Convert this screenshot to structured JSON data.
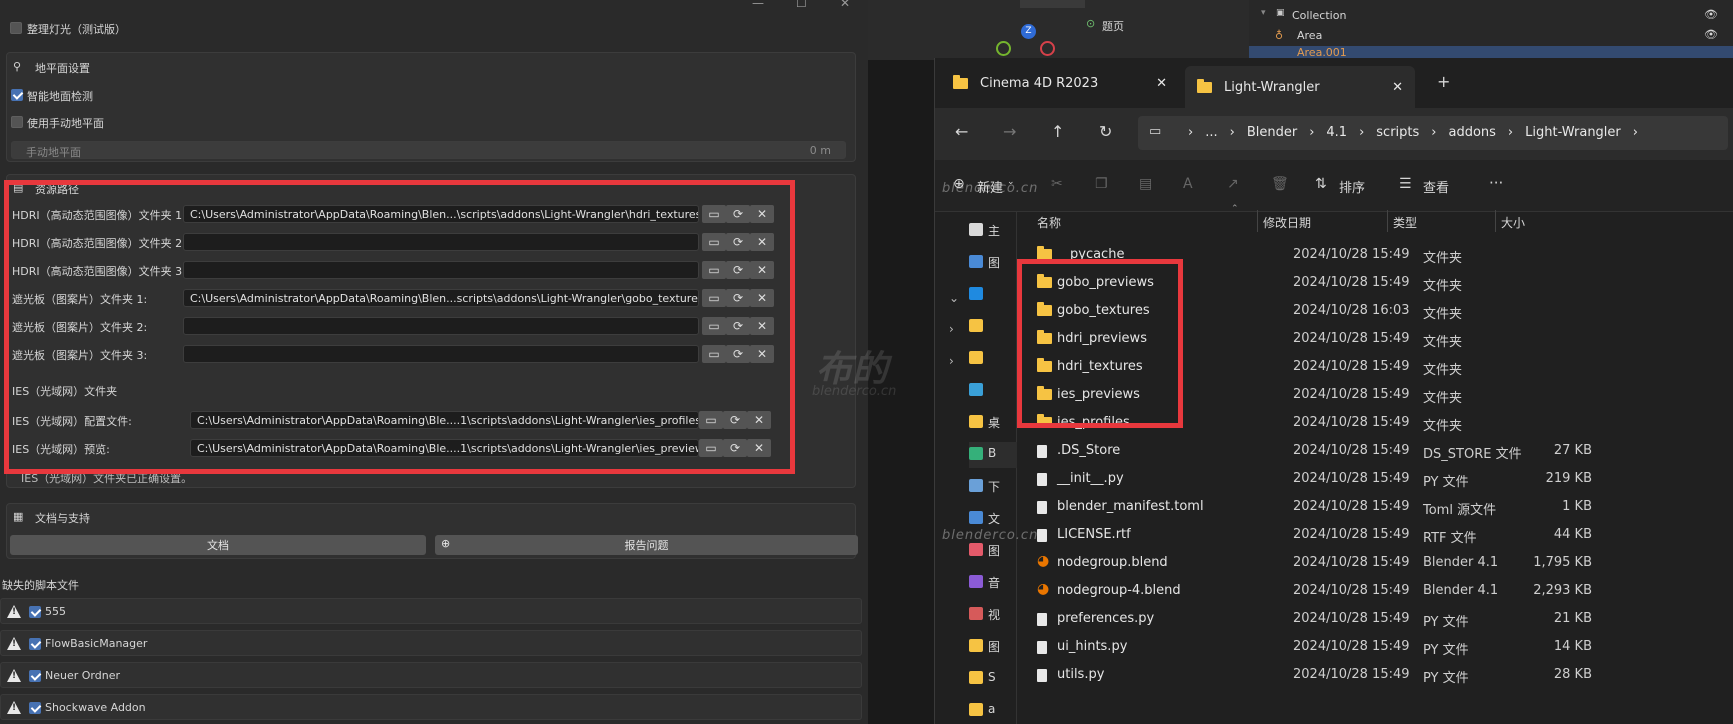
{
  "prefs": {
    "top_checkbox": "整理灯光（测试版）",
    "ground": {
      "title": "地平面设置",
      "smart": "智能地面检测",
      "manual": "使用手动地平面",
      "manual_field_label": "手动地平面",
      "manual_field_value": "0 m"
    },
    "resources": {
      "title": "资源路径",
      "rows": [
        {
          "label": "HDRI（高动态范围图像）文件夹 1:",
          "value": "C:\\Users\\Administrator\\AppData\\Roaming\\Blen...\\scripts\\addons\\Light-Wrangler\\hdri_textures\\"
        },
        {
          "label": "HDRI（高动态范围图像）文件夹 2:",
          "value": ""
        },
        {
          "label": "HDRI（高动态范围图像）文件夹 3:",
          "value": ""
        },
        {
          "label": "遮光板（图案片）文件夹 1:",
          "value": "C:\\Users\\Administrator\\AppData\\Roaming\\Blen...scripts\\addons\\Light-Wrangler\\gobo_textures\\"
        },
        {
          "label": "遮光板（图案片）文件夹 2:",
          "value": ""
        },
        {
          "label": "遮光板（图案片）文件夹 3:",
          "value": ""
        }
      ],
      "ies_title": "IES（光域网）文件夹",
      "ies_rows": [
        {
          "label": "IES（光域网）配置文件:",
          "value": "C:\\Users\\Administrator\\AppData\\Roaming\\Ble....1\\scripts\\addons\\Light-Wrangler\\ies_profiles\\"
        },
        {
          "label": "IES（光域网）预览:",
          "value": "C:\\Users\\Administrator\\AppData\\Roaming\\Ble....1\\scripts\\addons\\Light-Wrangler\\ies_previews\\"
        }
      ],
      "ies_note": "IES（光域网）文件夹已正确设置。"
    },
    "docs": {
      "title": "文档与支持",
      "doc_btn": "文档",
      "report_btn": "报告问题"
    },
    "missing": {
      "title": "缺失的脚本文件",
      "items": [
        "555",
        "FlowBasicManager",
        "Neuer Ordner",
        "Shockwave Addon"
      ]
    }
  },
  "viewport": {
    "overlay": "题页",
    "outliner": {
      "collection": "Collection",
      "area": "Area",
      "area001": "Area.001"
    },
    "axis_z": "Z"
  },
  "explorer": {
    "tabs": [
      "Cinema 4D R2023",
      "Light-Wrangler"
    ],
    "breadcrumb": [
      "...",
      "Blender",
      "4.1",
      "scripts",
      "addons",
      "Light-Wrangler"
    ],
    "toolbar": {
      "new": "新建",
      "sort": "排序",
      "view": "查看",
      "more": "···"
    },
    "columns": {
      "name": "名称",
      "date": "修改日期",
      "type": "类型",
      "size": "大小"
    },
    "files": [
      {
        "name": "__pycache__",
        "date": "2024/10/28 15:49",
        "type": "文件夹",
        "size": "",
        "kind": "folder"
      },
      {
        "name": "gobo_previews",
        "date": "2024/10/28 15:49",
        "type": "文件夹",
        "size": "",
        "kind": "folder"
      },
      {
        "name": "gobo_textures",
        "date": "2024/10/28 16:03",
        "type": "文件夹",
        "size": "",
        "kind": "folder"
      },
      {
        "name": "hdri_previews",
        "date": "2024/10/28 15:49",
        "type": "文件夹",
        "size": "",
        "kind": "folder"
      },
      {
        "name": "hdri_textures",
        "date": "2024/10/28 15:49",
        "type": "文件夹",
        "size": "",
        "kind": "folder"
      },
      {
        "name": "ies_previews",
        "date": "2024/10/28 15:49",
        "type": "文件夹",
        "size": "",
        "kind": "folder"
      },
      {
        "name": "ies_profiles",
        "date": "2024/10/28 15:49",
        "type": "文件夹",
        "size": "",
        "kind": "folder"
      },
      {
        "name": ".DS_Store",
        "date": "2024/10/28 15:49",
        "type": "DS_STORE 文件",
        "size": "27 KB",
        "kind": "file"
      },
      {
        "name": "__init__.py",
        "date": "2024/10/28 15:49",
        "type": "PY 文件",
        "size": "219 KB",
        "kind": "file"
      },
      {
        "name": "blender_manifest.toml",
        "date": "2024/10/28 15:49",
        "type": "Toml 源文件",
        "size": "1 KB",
        "kind": "file"
      },
      {
        "name": "LICENSE.rtf",
        "date": "2024/10/28 15:49",
        "type": "RTF 文件",
        "size": "44 KB",
        "kind": "file"
      },
      {
        "name": "nodegroup.blend",
        "date": "2024/10/28 15:49",
        "type": "Blender 4.1",
        "size": "1,795 KB",
        "kind": "blend"
      },
      {
        "name": "nodegroup-4.blend",
        "date": "2024/10/28 15:49",
        "type": "Blender 4.1",
        "size": "2,293 KB",
        "kind": "blend"
      },
      {
        "name": "preferences.py",
        "date": "2024/10/28 15:49",
        "type": "PY 文件",
        "size": "21 KB",
        "kind": "file"
      },
      {
        "name": "ui_hints.py",
        "date": "2024/10/28 15:49",
        "type": "PY 文件",
        "size": "14 KB",
        "kind": "file"
      },
      {
        "name": "utils.py",
        "date": "2024/10/28 15:49",
        "type": "PY 文件",
        "size": "28 KB",
        "kind": "file"
      }
    ],
    "nav_letters": [
      "主",
      "图",
      "",
      "",
      "",
      "",
      "桌",
      "B",
      "下",
      "文",
      "图",
      "音",
      "视",
      "图",
      "S",
      "a"
    ]
  },
  "watermark": {
    "url": "blenderco.cn",
    "cn": "布的"
  },
  "colors": {
    "highlight": "#e8383d",
    "accent": "#4772b3",
    "folder": "#f6c343"
  }
}
